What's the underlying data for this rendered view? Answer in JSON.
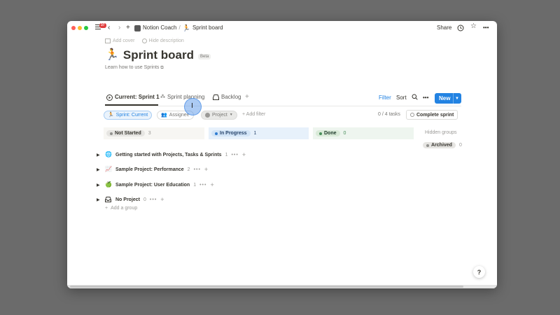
{
  "titlebar": {
    "notification_count": "37",
    "breadcrumbs": [
      "Notion Coach",
      "/",
      "Sprint board"
    ],
    "share_label": "Share"
  },
  "page": {
    "add_cover_label": "Add cover",
    "hide_description_label": "Hide description",
    "title": "Sprint board",
    "beta_label": "Beta",
    "learn_link": "Learn how to use Sprints"
  },
  "views": {
    "tabs": [
      {
        "label": "Current: Sprint 1",
        "active": true
      },
      {
        "label": "Sprint planning",
        "active": false
      },
      {
        "label": "Backlog",
        "active": false
      }
    ],
    "filter_label": "Filter",
    "sort_label": "Sort",
    "new_label": "New"
  },
  "filters": {
    "sprint_pill": "Sprint: Current",
    "assignee_pill": "Assignee",
    "project_pill": "Project",
    "add_filter": "Add filter",
    "task_count": "0 / 4 tasks",
    "complete_sprint": "Complete sprint"
  },
  "columns": [
    {
      "label": "Not Started",
      "count": "3"
    },
    {
      "label": "In Progress",
      "count": "1"
    },
    {
      "label": "Done",
      "count": "0"
    }
  ],
  "hidden_groups": {
    "label": "Hidden groups",
    "archived_label": "Archived",
    "archived_count": "0"
  },
  "groups": [
    {
      "icon": "globe-icon",
      "name": "Getting started with Projects, Tasks & Sprints",
      "count": "1"
    },
    {
      "icon": "chart-icon",
      "name": "Sample Project: Performance",
      "count": "2"
    },
    {
      "icon": "apple-icon",
      "name": "Sample Project: User Education",
      "count": "1"
    },
    {
      "icon": "inbox-icon",
      "name": "No Project",
      "count": "0"
    }
  ],
  "add_group_label": "Add a group",
  "help_label": "?",
  "colors": {
    "accent": "#2383e2",
    "in_progress": "#2e7cd1",
    "done": "#4a8f5c",
    "not_started": "#91918e"
  }
}
